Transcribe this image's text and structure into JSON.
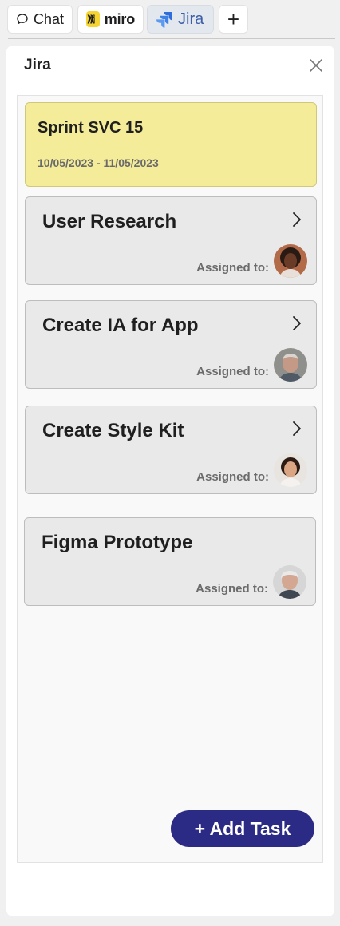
{
  "tabs": [
    {
      "label": "Chat",
      "icon": "chat-bubble-icon"
    },
    {
      "label": "miro",
      "icon": "miro-logo-icon"
    },
    {
      "label": "Jira",
      "icon": "jira-logo-icon",
      "active": true
    },
    {
      "label": "+",
      "icon": "plus-icon"
    }
  ],
  "panel": {
    "title": "Jira",
    "close_icon": "close-icon"
  },
  "sprint": {
    "title": "Sprint SVC 15",
    "dates": "10/05/2023 - 11/05/2023"
  },
  "tasks": [
    {
      "title": "User Research",
      "assigned_label": "Assigned to:",
      "has_chevron": true,
      "avatar": "avatar-woman-curly"
    },
    {
      "title": "Create IA for App",
      "assigned_label": "Assigned to:",
      "has_chevron": true,
      "avatar": "avatar-older-man"
    },
    {
      "title": "Create Style Kit",
      "assigned_label": "Assigned to:",
      "has_chevron": true,
      "avatar": "avatar-young-woman"
    },
    {
      "title": "Figma Prototype",
      "assigned_label": "Assigned to:",
      "has_chevron": false,
      "avatar": "avatar-gray-haired-man"
    }
  ],
  "add_task_label": "+ Add Task",
  "colors": {
    "sprint_bg": "#f5ec9a",
    "task_bg": "#e9e9e9",
    "add_button": "#2b2b86",
    "jira_blue": "#3c5fa8",
    "miro_yellow": "#f6d532"
  }
}
